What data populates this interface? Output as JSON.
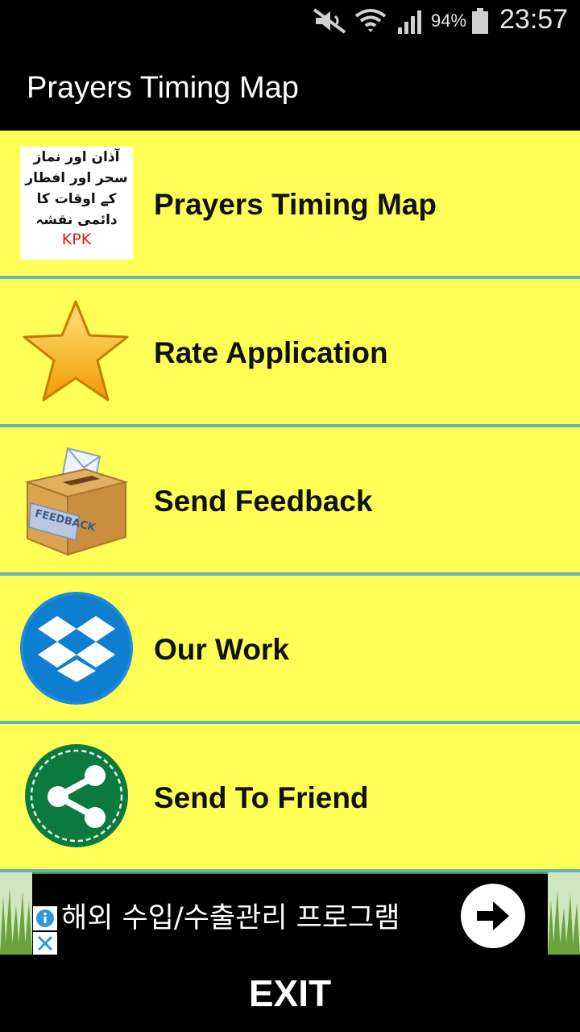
{
  "status_bar": {
    "battery_percent": "94%",
    "time": "23:57",
    "icons": [
      "mute-icon",
      "wifi-icon",
      "signal-icon",
      "battery-icon"
    ]
  },
  "app": {
    "title": "Prayers Timing Map"
  },
  "menu": {
    "items": [
      {
        "label": "Prayers Timing Map",
        "icon": "prayer-map-thumbnail"
      },
      {
        "label": "Rate Application",
        "icon": "star-icon"
      },
      {
        "label": "Send Feedback",
        "icon": "feedback-box-icon"
      },
      {
        "label": "Our Work",
        "icon": "dropbox-icon"
      },
      {
        "label": "Send To Friend",
        "icon": "share-icon"
      }
    ],
    "thumbnail": {
      "urdu_lines": [
        "آذان اور نماز",
        "سحر اور افطار",
        "کے اوقات کا",
        "دائمی نقشہ"
      ],
      "region": "KPK"
    }
  },
  "ad": {
    "text": "해외 수입/수출관리 프로그램"
  },
  "footer": {
    "exit_label": "EXIT"
  },
  "colors": {
    "menu_background": "#ffff55",
    "divider": "#5fb7b5",
    "bars": "#000000"
  }
}
